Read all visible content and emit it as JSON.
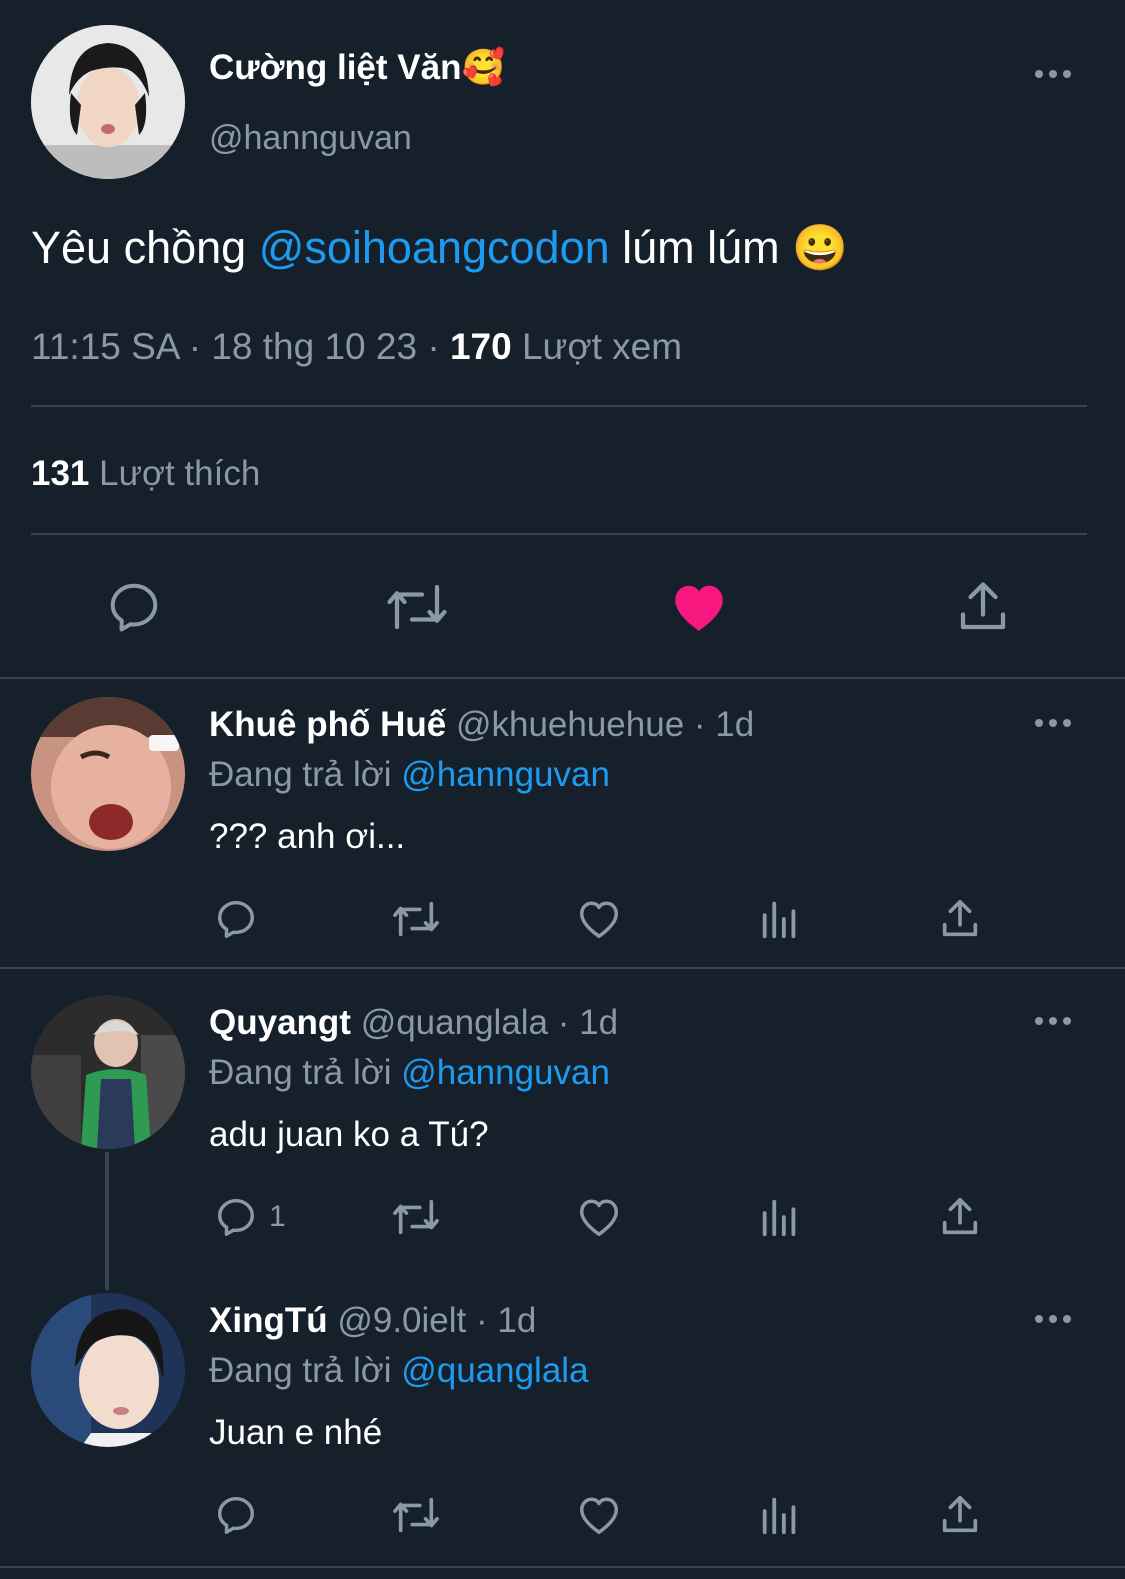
{
  "main_tweet": {
    "display_name": "Cường liệt Văn",
    "display_name_emoji": "🥰",
    "handle": "@hannguvan",
    "text_before": "Yêu chồng ",
    "mention": "@soihoangcodon",
    "text_after": " lúm lúm ",
    "emoji": "😀",
    "time": "11:15 SA · 18 thg 10 23 · ",
    "views": "170",
    "views_label": " Lượt xem",
    "likes": "131",
    "likes_label": " Lượt thích",
    "liked": true,
    "like_color": "#f91880"
  },
  "replies": [
    {
      "display_name": "Khuê phố Huế",
      "handle": "@khuehuehue · 1d",
      "replying_prefix": "Đang trả lời ",
      "replying_to": "@hannguvan",
      "text": "??? anh ơi...",
      "reply_count": ""
    },
    {
      "display_name": "Quyangt",
      "handle": "@quanglala · 1d",
      "replying_prefix": "Đang trả lời ",
      "replying_to": "@hannguvan",
      "text": "adu juan ko a Tú?",
      "reply_count": "1"
    },
    {
      "display_name": "XingTú",
      "handle": "@9.0ielt · 1d",
      "replying_prefix": "Đang trả lời ",
      "replying_to": "@quanglala",
      "text": "Juan e nhé",
      "reply_count": ""
    }
  ],
  "colors": {
    "background": "#15202b",
    "muted": "#8b98a5",
    "link": "#1d9bf0",
    "divider": "#38444d"
  }
}
